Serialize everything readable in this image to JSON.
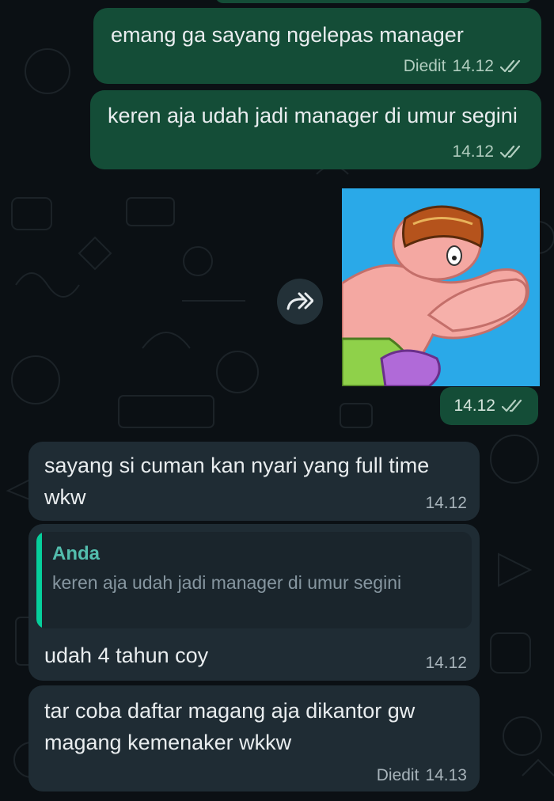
{
  "colors": {
    "background": "#0b1014",
    "outgoing_bubble": "#144d37",
    "incoming_bubble": "#1f2c34",
    "read_ticks": "#b1cdbf",
    "quote_author": "#53bdad",
    "quote_bar": "#06cf9c"
  },
  "messages": [
    {
      "direction": "out",
      "text": "emang ga sayang ngelepas manager",
      "edited_label": "Diedit",
      "time": "14.12",
      "status_icon": "double-check-icon"
    },
    {
      "direction": "out",
      "text": "keren aja udah jadi manager di umur segini",
      "time": "14.12",
      "status_icon": "double-check-icon"
    },
    {
      "direction": "out",
      "type": "sticker",
      "sticker_icon": "cartoon-character-sticker",
      "time": "14.12",
      "status_icon": "double-check-icon",
      "forward_icon": "forward-icon"
    },
    {
      "direction": "in",
      "text": "sayang si cuman kan nyari yang full time wkw",
      "time": "14.12"
    },
    {
      "direction": "in",
      "reply": {
        "author": "Anda",
        "text": "keren aja udah jadi manager di umur segini"
      },
      "text": "udah 4 tahun coy",
      "time": "14.12"
    },
    {
      "direction": "in",
      "text": "tar coba daftar magang aja dikantor gw magang  kemenaker wkkw",
      "edited_label": "Diedit",
      "time": "14.13"
    }
  ]
}
